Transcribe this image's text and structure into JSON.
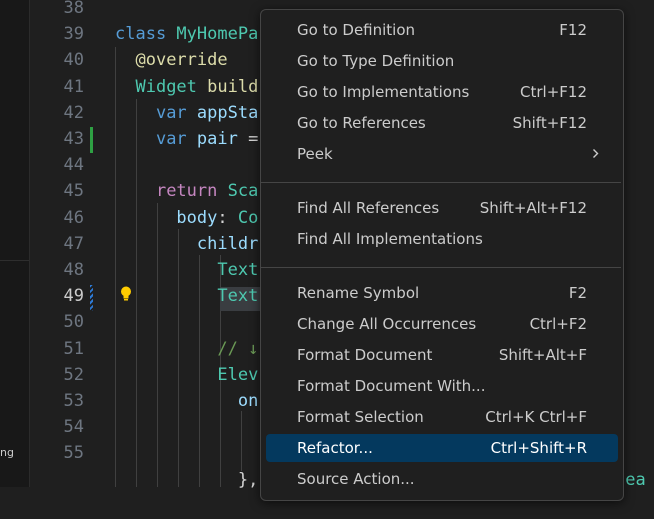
{
  "sidebar": {
    "fragment_text": "ng"
  },
  "editor": {
    "lines": [
      {
        "num": "38",
        "tokens": []
      },
      {
        "num": "39",
        "tokens": [
          {
            "t": "class ",
            "c": "kw"
          },
          {
            "t": "MyHomePa",
            "c": "cls"
          }
        ]
      },
      {
        "num": "40",
        "tokens": [
          {
            "t": "  ",
            "c": ""
          },
          {
            "t": "@override",
            "c": "dec"
          }
        ]
      },
      {
        "num": "41",
        "tokens": [
          {
            "t": "  ",
            "c": ""
          },
          {
            "t": "Widget ",
            "c": "cls"
          },
          {
            "t": "build",
            "c": "dec"
          }
        ]
      },
      {
        "num": "42",
        "tokens": [
          {
            "t": "    ",
            "c": ""
          },
          {
            "t": "var ",
            "c": "kw"
          },
          {
            "t": "appSta",
            "c": "var"
          }
        ]
      },
      {
        "num": "43",
        "tokens": [
          {
            "t": "    ",
            "c": ""
          },
          {
            "t": "var ",
            "c": "kw"
          },
          {
            "t": "pair",
            "c": "var"
          },
          {
            "t": " =",
            "c": ""
          }
        ]
      },
      {
        "num": "44",
        "tokens": []
      },
      {
        "num": "45",
        "tokens": [
          {
            "t": "    ",
            "c": ""
          },
          {
            "t": "return ",
            "c": "ctrl"
          },
          {
            "t": "Sca",
            "c": "cls"
          }
        ]
      },
      {
        "num": "46",
        "tokens": [
          {
            "t": "      ",
            "c": ""
          },
          {
            "t": "body",
            "c": "var"
          },
          {
            "t": ": ",
            "c": ""
          },
          {
            "t": "Co",
            "c": "cls"
          }
        ]
      },
      {
        "num": "47",
        "tokens": [
          {
            "t": "        ",
            "c": ""
          },
          {
            "t": "childr",
            "c": "var"
          }
        ]
      },
      {
        "num": "48",
        "tokens": [
          {
            "t": "          ",
            "c": ""
          },
          {
            "t": "Text",
            "c": "cls"
          }
        ]
      },
      {
        "num": "49",
        "tokens": [
          {
            "t": "          ",
            "c": ""
          },
          {
            "t": "Text",
            "c": "cls"
          }
        ]
      },
      {
        "num": "50",
        "tokens": []
      },
      {
        "num": "51",
        "tokens": [
          {
            "t": "          ",
            "c": ""
          },
          {
            "t": "// ↓",
            "c": "cmt"
          }
        ]
      },
      {
        "num": "52",
        "tokens": [
          {
            "t": "          ",
            "c": ""
          },
          {
            "t": "Elev",
            "c": "cls"
          }
        ]
      },
      {
        "num": "53",
        "tokens": [
          {
            "t": "            ",
            "c": ""
          },
          {
            "t": "on",
            "c": "var"
          }
        ]
      },
      {
        "num": "54",
        "tokens": []
      },
      {
        "num": "55",
        "tokens": []
      },
      {
        "num": "",
        "tokens": [
          {
            "t": "            ",
            "c": ""
          },
          {
            "t": "},",
            "c": ""
          }
        ]
      }
    ],
    "active_line": "49",
    "trailing_fragment": "tea"
  },
  "context_menu": {
    "groups": [
      [
        {
          "label": "Go to Definition",
          "shortcut": "F12"
        },
        {
          "label": "Go to Type Definition",
          "shortcut": ""
        },
        {
          "label": "Go to Implementations",
          "shortcut": "Ctrl+F12"
        },
        {
          "label": "Go to References",
          "shortcut": "Shift+F12"
        },
        {
          "label": "Peek",
          "shortcut": "",
          "submenu": true
        }
      ],
      [
        {
          "label": "Find All References",
          "shortcut": "Shift+Alt+F12"
        },
        {
          "label": "Find All Implementations",
          "shortcut": ""
        }
      ],
      [
        {
          "label": "Rename Symbol",
          "shortcut": "F2"
        },
        {
          "label": "Change All Occurrences",
          "shortcut": "Ctrl+F2"
        },
        {
          "label": "Format Document",
          "shortcut": "Shift+Alt+F"
        },
        {
          "label": "Format Document With...",
          "shortcut": ""
        },
        {
          "label": "Format Selection",
          "shortcut": "Ctrl+K Ctrl+F"
        },
        {
          "label": "Refactor...",
          "shortcut": "Ctrl+Shift+R",
          "highlighted": true
        },
        {
          "label": "Source Action...",
          "shortcut": ""
        }
      ]
    ]
  },
  "colors": {
    "menu_highlight": "#04395e",
    "modified_bar": "#2ea043",
    "lightbulb": "#ffcc00"
  }
}
